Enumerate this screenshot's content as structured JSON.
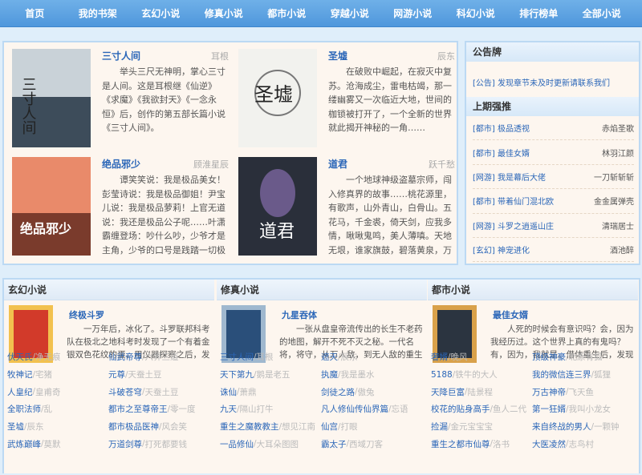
{
  "nav": [
    "首页",
    "我的书架",
    "玄幻小说",
    "修真小说",
    "都市小说",
    "穿越小说",
    "网游小说",
    "科幻小说",
    "排行榜单",
    "全部小说"
  ],
  "featured": [
    {
      "title": "三寸人间",
      "author": "耳根",
      "desc": "举头三尺无神明，掌心三寸是人间。这是耳根继《仙逆》《求魔》《我欲封天》《一念永恒》后，创作的第五部长篇小说《三寸人间》。",
      "cover_text": "三寸人间",
      "cover_colors": [
        "#3d4c5a",
        "#c9d2d8"
      ]
    },
    {
      "title": "圣墟",
      "author": "辰东",
      "desc": "在破败中崛起，在寂灭中复苏。沧海成尘，雷电枯竭，那一缕幽雾又一次临近大地，世间的枷锁被打开了，一个全新的世界就此揭开神秘的一角……",
      "cover_text": "圣墟",
      "cover_colors": [
        "#f2f2ee",
        "#555"
      ]
    },
    {
      "title": "绝品邪少",
      "author": "顾淮星辰",
      "desc": "谭笑笑说：我是极品美女！彭莹诗说：我是极品御姐！尹宝儿说：我是极品萝莉！上官无道说：我还是极品公子呢……叶潇霸缠登场：吵什么吵，少爷才是主角，少爷的口号是践踏一切极品，只做人",
      "cover_text": "绝品邪少",
      "cover_colors": [
        "#e98a6a",
        "#7a3b2c"
      ]
    },
    {
      "title": "道君",
      "author": "跃千愁",
      "desc": "一个地球神级盗墓宗师，闯入修真界的故事……桃花源里，有歌声，山外青山，白骨山。五花马，千金裘，倚天剑，应我多情，啾啾鬼鸣，美人薄嗔。天地无垠，谁家旗鼓，碧落黄泉，万古高楼。",
      "cover_text": "道君",
      "cover_colors": [
        "#2a2f3a",
        "#6a5a8a"
      ]
    }
  ],
  "notice": {
    "title": "公告牌",
    "text": "[公告] 发现章节未及时更新请联系我们"
  },
  "ranking": {
    "title": "上期强推",
    "items": [
      {
        "left": "[都市] 极品透视",
        "right": "赤焰圣歌"
      },
      {
        "left": "[都市] 最佳女婿",
        "right": "林羽江颜"
      },
      {
        "left": "[网游] 我是幕后大佬",
        "right": "一刀斩斩斩"
      },
      {
        "left": "[都市] 带着仙门混北欧",
        "right": "金金属弹壳"
      },
      {
        "left": "[网游] 斗罗之逍遥山庄",
        "right": "清瑞居士"
      },
      {
        "left": "[玄幻] 神宠进化",
        "right": "酒池醉"
      }
    ]
  },
  "categories": [
    {
      "name": "玄幻小说",
      "feat_title": "终极斗罗",
      "feat_desc": "一万年后，冰化了。斗罗联邦科考队在极北之地科考时发现了一个有着金银双色花纹的蛋，用仪器探察之后，发现里面居然",
      "cover_colors": [
        "#d23a2a",
        "#f2c14e"
      ],
      "items": [
        [
          "伏天氏",
          "净无痕"
        ],
        [
          "仙武帝尊",
          "六界三道"
        ],
        [
          "牧神记",
          "宅猪"
        ],
        [
          "元尊",
          "天蚕土豆"
        ],
        [
          "人皇纪",
          "皇甫奇"
        ],
        [
          "斗破苍穹",
          "天蚕土豆"
        ],
        [
          "全职法师",
          "乱"
        ],
        [
          "都市之至尊帝王",
          "零一度"
        ],
        [
          "圣墟",
          "辰东"
        ],
        [
          "都市极品医神",
          "风会笑"
        ],
        [
          "武炼巅峰",
          "莫默"
        ],
        [
          "万道剑尊",
          "打死都要钱"
        ]
      ]
    },
    {
      "name": "修真小说",
      "feat_title": "九星吞体",
      "feat_desc": "一张从盘皇帝流传出的长生不老药的地图，解开不死不灭之秘。一代名将，将守，从万人敌，到无人敌的重生之路！",
      "cover_colors": [
        "#2a4f7a",
        "#9fb8cf"
      ],
      "items": [
        [
          "三寸人间",
          "耳根"
        ],
        [
          "遮天",
          "辰东"
        ],
        [
          "天下第九",
          "鹅是老五"
        ],
        [
          "执魔",
          "我是墨水"
        ],
        [
          "诛仙",
          "萧鼎"
        ],
        [
          "剑徒之路",
          "傲兔"
        ],
        [
          "九天",
          "隔山打牛"
        ],
        [
          "凡人修仙传仙界篇",
          "忘语"
        ],
        [
          "重生之魔教教主",
          "想见江南"
        ],
        [
          "仙宫",
          "打眼"
        ],
        [
          "一品修仙",
          "大耳朵图图"
        ],
        [
          "霸太子",
          "西域刀客"
        ]
      ]
    },
    {
      "name": "都市小说",
      "feat_title": "最佳女婿",
      "feat_desc": "人死的时候会有意识吗？会，因为我经历过。这个世界上真的有鬼吗？有，因为，我就是。借体重生后，发现他有一个",
      "cover_colors": [
        "#2b3440",
        "#d9a14a"
      ],
      "items": [
        [
          "奢婿",
          "晚风"
        ],
        [
          "顶级神豪",
          "北原有狐"
        ],
        [
          "5188",
          "铁牛的大人"
        ],
        [
          "我的微信连三界",
          "狐狸"
        ],
        [
          "天降巨富",
          "陆景程"
        ],
        [
          "万古神帝",
          "飞天鱼"
        ],
        [
          "校花的贴身高手",
          "鱼人二代"
        ],
        [
          "第一狂婿",
          "我叫小龙女"
        ],
        [
          "捡漏",
          "金元宝宝宝"
        ],
        [
          "来自终战的男人",
          "一颗钟"
        ],
        [
          "重生之都市仙尊",
          "洛书"
        ],
        [
          "大医凌然",
          "志鸟村"
        ]
      ]
    }
  ]
}
